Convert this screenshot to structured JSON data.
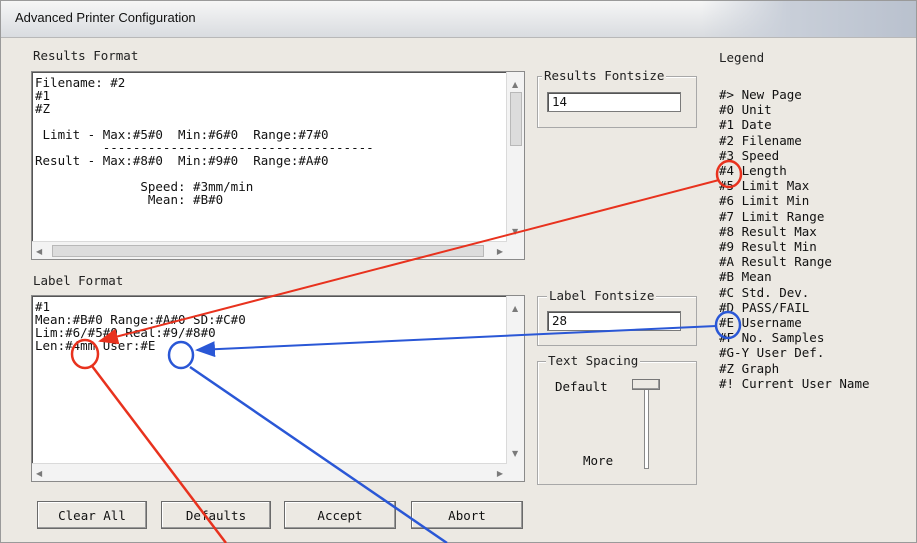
{
  "window": {
    "title": "Advanced Printer Configuration"
  },
  "results_format": {
    "label": "Results Format",
    "text": "Filename: #2\n#1\n#Z\n\n Limit - Max:#5#0  Min:#6#0  Range:#7#0\n         ------------------------------------\nResult - Max:#8#0  Min:#9#0  Range:#A#0\n\n              Speed: #3mm/min\n               Mean: #B#0"
  },
  "results_fontsize": {
    "label": "Results Fontsize",
    "value": "14"
  },
  "label_format": {
    "label": "Label Format",
    "text": "#1\nMean:#B#0 Range:#A#0 SD:#C#0\nLim:#6/#5#0 Real:#9/#8#0\nLen:#4mm User:#E"
  },
  "label_fontsize": {
    "label": "Label Fontsize",
    "value": "28"
  },
  "text_spacing": {
    "label": "Text Spacing",
    "top_label": "Default",
    "bottom_label": "More"
  },
  "legend": {
    "label": "Legend",
    "text": "#> New Page\n#0 Unit\n#1 Date\n#2 Filename\n#3 Speed\n#4 Length\n#5 Limit Max\n#6 Limit Min\n#7 Limit Range\n#8 Result Max\n#9 Result Min\n#A Result Range\n#B Mean\n#C Std. Dev.\n#D PASS/FAIL\n#E Username\n#F No. Samples\n#G-Y User Def.\n#Z Graph\n#! Current User Name"
  },
  "buttons": {
    "clear_all": "Clear All",
    "defaults": "Defaults",
    "accept": "Accept",
    "abort": "Abort"
  },
  "annotation_colors": {
    "red": "#e8321e",
    "blue": "#2a57d6"
  }
}
